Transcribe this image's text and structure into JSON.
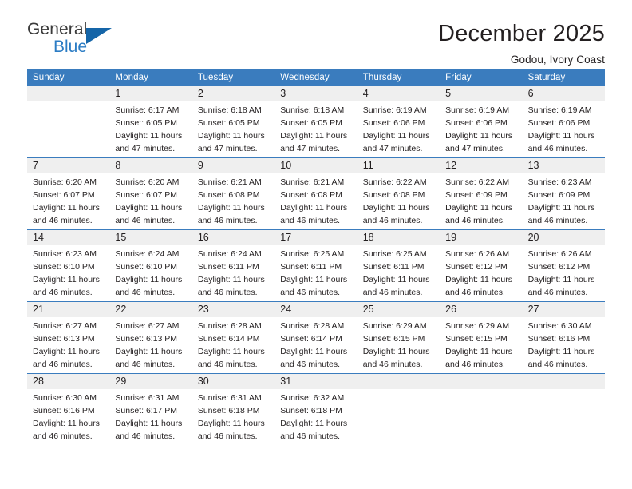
{
  "brand": {
    "name_top": "General",
    "name_bottom": "Blue",
    "triangle_color": "#1565a8",
    "blue_text_color": "#2b7cc4"
  },
  "header": {
    "title": "December 2025",
    "subtitle": "Godou, Ivory Coast"
  },
  "theme": {
    "header_blue": "#3a7cbe",
    "daynum_band": "#efefef",
    "text": "#231f20"
  },
  "weekdays": [
    "Sunday",
    "Monday",
    "Tuesday",
    "Wednesday",
    "Thursday",
    "Friday",
    "Saturday"
  ],
  "weeks": [
    [
      {
        "day": "",
        "sunrise": "",
        "sunset": "",
        "daylight1": "",
        "daylight2": ""
      },
      {
        "day": "1",
        "sunrise": "Sunrise: 6:17 AM",
        "sunset": "Sunset: 6:05 PM",
        "daylight1": "Daylight: 11 hours",
        "daylight2": "and 47 minutes."
      },
      {
        "day": "2",
        "sunrise": "Sunrise: 6:18 AM",
        "sunset": "Sunset: 6:05 PM",
        "daylight1": "Daylight: 11 hours",
        "daylight2": "and 47 minutes."
      },
      {
        "day": "3",
        "sunrise": "Sunrise: 6:18 AM",
        "sunset": "Sunset: 6:05 PM",
        "daylight1": "Daylight: 11 hours",
        "daylight2": "and 47 minutes."
      },
      {
        "day": "4",
        "sunrise": "Sunrise: 6:19 AM",
        "sunset": "Sunset: 6:06 PM",
        "daylight1": "Daylight: 11 hours",
        "daylight2": "and 47 minutes."
      },
      {
        "day": "5",
        "sunrise": "Sunrise: 6:19 AM",
        "sunset": "Sunset: 6:06 PM",
        "daylight1": "Daylight: 11 hours",
        "daylight2": "and 47 minutes."
      },
      {
        "day": "6",
        "sunrise": "Sunrise: 6:19 AM",
        "sunset": "Sunset: 6:06 PM",
        "daylight1": "Daylight: 11 hours",
        "daylight2": "and 46 minutes."
      }
    ],
    [
      {
        "day": "7",
        "sunrise": "Sunrise: 6:20 AM",
        "sunset": "Sunset: 6:07 PM",
        "daylight1": "Daylight: 11 hours",
        "daylight2": "and 46 minutes."
      },
      {
        "day": "8",
        "sunrise": "Sunrise: 6:20 AM",
        "sunset": "Sunset: 6:07 PM",
        "daylight1": "Daylight: 11 hours",
        "daylight2": "and 46 minutes."
      },
      {
        "day": "9",
        "sunrise": "Sunrise: 6:21 AM",
        "sunset": "Sunset: 6:08 PM",
        "daylight1": "Daylight: 11 hours",
        "daylight2": "and 46 minutes."
      },
      {
        "day": "10",
        "sunrise": "Sunrise: 6:21 AM",
        "sunset": "Sunset: 6:08 PM",
        "daylight1": "Daylight: 11 hours",
        "daylight2": "and 46 minutes."
      },
      {
        "day": "11",
        "sunrise": "Sunrise: 6:22 AM",
        "sunset": "Sunset: 6:08 PM",
        "daylight1": "Daylight: 11 hours",
        "daylight2": "and 46 minutes."
      },
      {
        "day": "12",
        "sunrise": "Sunrise: 6:22 AM",
        "sunset": "Sunset: 6:09 PM",
        "daylight1": "Daylight: 11 hours",
        "daylight2": "and 46 minutes."
      },
      {
        "day": "13",
        "sunrise": "Sunrise: 6:23 AM",
        "sunset": "Sunset: 6:09 PM",
        "daylight1": "Daylight: 11 hours",
        "daylight2": "and 46 minutes."
      }
    ],
    [
      {
        "day": "14",
        "sunrise": "Sunrise: 6:23 AM",
        "sunset": "Sunset: 6:10 PM",
        "daylight1": "Daylight: 11 hours",
        "daylight2": "and 46 minutes."
      },
      {
        "day": "15",
        "sunrise": "Sunrise: 6:24 AM",
        "sunset": "Sunset: 6:10 PM",
        "daylight1": "Daylight: 11 hours",
        "daylight2": "and 46 minutes."
      },
      {
        "day": "16",
        "sunrise": "Sunrise: 6:24 AM",
        "sunset": "Sunset: 6:11 PM",
        "daylight1": "Daylight: 11 hours",
        "daylight2": "and 46 minutes."
      },
      {
        "day": "17",
        "sunrise": "Sunrise: 6:25 AM",
        "sunset": "Sunset: 6:11 PM",
        "daylight1": "Daylight: 11 hours",
        "daylight2": "and 46 minutes."
      },
      {
        "day": "18",
        "sunrise": "Sunrise: 6:25 AM",
        "sunset": "Sunset: 6:11 PM",
        "daylight1": "Daylight: 11 hours",
        "daylight2": "and 46 minutes."
      },
      {
        "day": "19",
        "sunrise": "Sunrise: 6:26 AM",
        "sunset": "Sunset: 6:12 PM",
        "daylight1": "Daylight: 11 hours",
        "daylight2": "and 46 minutes."
      },
      {
        "day": "20",
        "sunrise": "Sunrise: 6:26 AM",
        "sunset": "Sunset: 6:12 PM",
        "daylight1": "Daylight: 11 hours",
        "daylight2": "and 46 minutes."
      }
    ],
    [
      {
        "day": "21",
        "sunrise": "Sunrise: 6:27 AM",
        "sunset": "Sunset: 6:13 PM",
        "daylight1": "Daylight: 11 hours",
        "daylight2": "and 46 minutes."
      },
      {
        "day": "22",
        "sunrise": "Sunrise: 6:27 AM",
        "sunset": "Sunset: 6:13 PM",
        "daylight1": "Daylight: 11 hours",
        "daylight2": "and 46 minutes."
      },
      {
        "day": "23",
        "sunrise": "Sunrise: 6:28 AM",
        "sunset": "Sunset: 6:14 PM",
        "daylight1": "Daylight: 11 hours",
        "daylight2": "and 46 minutes."
      },
      {
        "day": "24",
        "sunrise": "Sunrise: 6:28 AM",
        "sunset": "Sunset: 6:14 PM",
        "daylight1": "Daylight: 11 hours",
        "daylight2": "and 46 minutes."
      },
      {
        "day": "25",
        "sunrise": "Sunrise: 6:29 AM",
        "sunset": "Sunset: 6:15 PM",
        "daylight1": "Daylight: 11 hours",
        "daylight2": "and 46 minutes."
      },
      {
        "day": "26",
        "sunrise": "Sunrise: 6:29 AM",
        "sunset": "Sunset: 6:15 PM",
        "daylight1": "Daylight: 11 hours",
        "daylight2": "and 46 minutes."
      },
      {
        "day": "27",
        "sunrise": "Sunrise: 6:30 AM",
        "sunset": "Sunset: 6:16 PM",
        "daylight1": "Daylight: 11 hours",
        "daylight2": "and 46 minutes."
      }
    ],
    [
      {
        "day": "28",
        "sunrise": "Sunrise: 6:30 AM",
        "sunset": "Sunset: 6:16 PM",
        "daylight1": "Daylight: 11 hours",
        "daylight2": "and 46 minutes."
      },
      {
        "day": "29",
        "sunrise": "Sunrise: 6:31 AM",
        "sunset": "Sunset: 6:17 PM",
        "daylight1": "Daylight: 11 hours",
        "daylight2": "and 46 minutes."
      },
      {
        "day": "30",
        "sunrise": "Sunrise: 6:31 AM",
        "sunset": "Sunset: 6:18 PM",
        "daylight1": "Daylight: 11 hours",
        "daylight2": "and 46 minutes."
      },
      {
        "day": "31",
        "sunrise": "Sunrise: 6:32 AM",
        "sunset": "Sunset: 6:18 PM",
        "daylight1": "Daylight: 11 hours",
        "daylight2": "and 46 minutes."
      },
      {
        "day": "",
        "sunrise": "",
        "sunset": "",
        "daylight1": "",
        "daylight2": ""
      },
      {
        "day": "",
        "sunrise": "",
        "sunset": "",
        "daylight1": "",
        "daylight2": ""
      },
      {
        "day": "",
        "sunrise": "",
        "sunset": "",
        "daylight1": "",
        "daylight2": ""
      }
    ]
  ]
}
